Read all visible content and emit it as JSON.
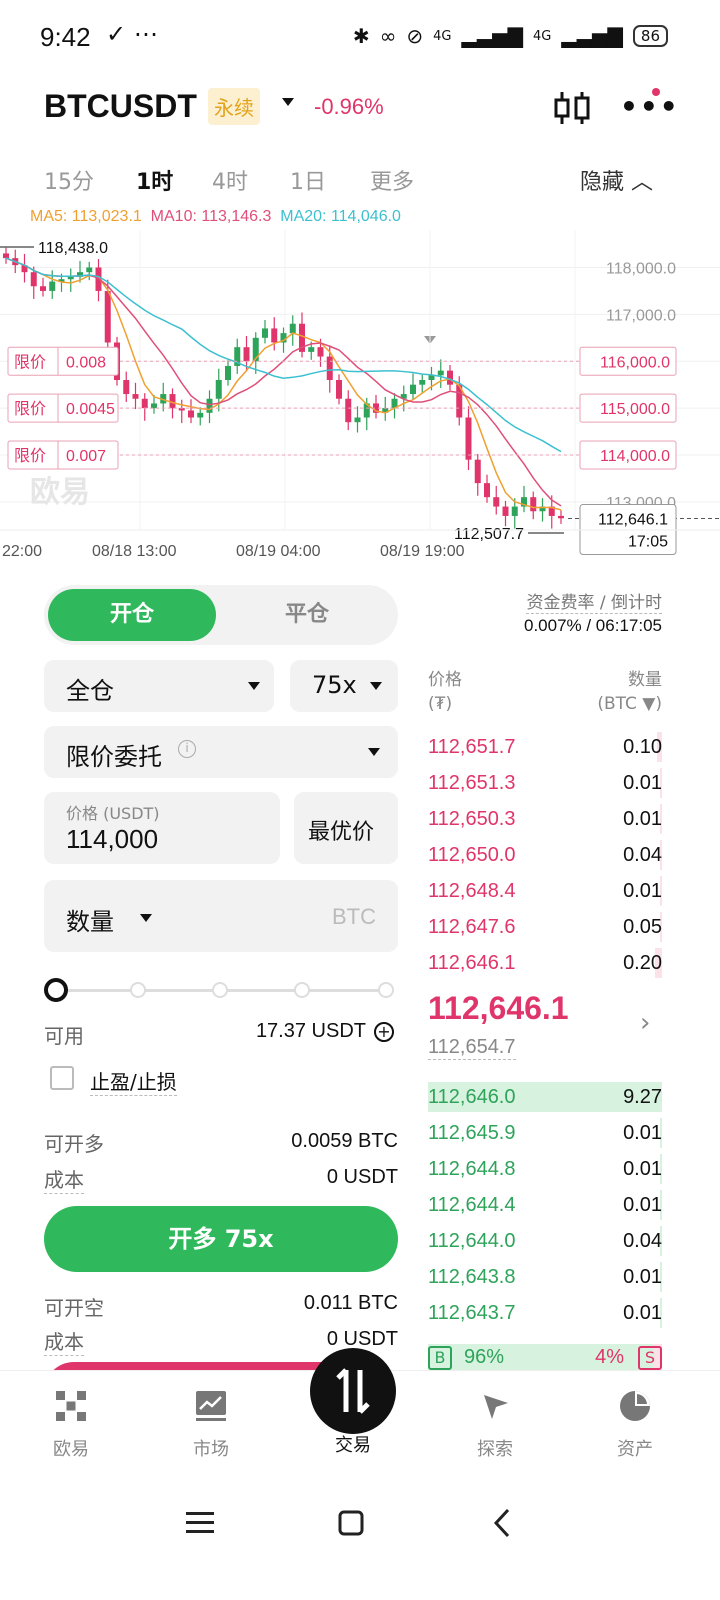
{
  "status_bar": {
    "time": "9:42",
    "network_1": "4G",
    "network_2": "4G",
    "battery": "86"
  },
  "header": {
    "symbol": "BTCUSDT",
    "contract_type": "永续",
    "change": "-0.96%"
  },
  "timeframes": [
    {
      "label": "15分",
      "active": false
    },
    {
      "label": "1时",
      "active": true
    },
    {
      "label": "4时",
      "active": false
    },
    {
      "label": "1日",
      "active": false
    },
    {
      "label": "更多",
      "active": false
    }
  ],
  "hide_label": "隐藏",
  "ma": {
    "ma5": "MA5: 113,023.1",
    "ma10": "MA10: 113,146.3",
    "ma20": "MA20: 114,046.0"
  },
  "colors": {
    "up": "#2ea35a",
    "down": "#e0356a",
    "ma5": "#f0a030",
    "ma10": "#e04f7a",
    "ma20": "#3cc0d0",
    "accent": "#30b95c"
  },
  "chart_data": {
    "type": "candlestick",
    "y_ticks": [
      "118,000.0",
      "117,000.0",
      "116,000.0",
      "115,000.0",
      "114,000.0",
      "113,000.0"
    ],
    "x_ticks": [
      "22:00",
      "08/18 13:00",
      "08/19 04:00",
      "08/19 19:00"
    ],
    "high_label": "118,438.0",
    "low_label": "112,507.7",
    "current_price": "112,646.1",
    "countdown": "17:05",
    "ylim": [
      112400,
      118800
    ],
    "orders": [
      {
        "label": "限价",
        "qty": "0.008",
        "price": 116000
      },
      {
        "label": "限价",
        "qty": "0.0045",
        "price": 115000
      },
      {
        "label": "限价",
        "qty": "0.007",
        "price": 114000
      }
    ],
    "watermark": "欧易"
  },
  "trade": {
    "tab_open": "开仓",
    "tab_close": "平仓",
    "funding_label": "资金费率 / 倒计时",
    "funding_value": "0.007% / 06:17:05",
    "margin_mode": "全仓",
    "leverage": "75x",
    "order_type": "限价委托",
    "price_label": "价格 (USDT)",
    "price_value": "114,000",
    "best_price": "最优价",
    "qty_label": "数量",
    "qty_placeholder": "BTC",
    "available_label": "可用",
    "available_value": "17.37 USDT",
    "tpsl_label": "止盈/止损",
    "long_max_label": "可开多",
    "long_max_value": "0.0059 BTC",
    "long_cost_label": "成本",
    "long_cost_value": "0 USDT",
    "buy_button": "开多 75x",
    "short_max_label": "可开空",
    "short_max_value": "0.011 BTC",
    "short_cost_label": "成本",
    "short_cost_value": "0 USDT",
    "slider_percent": 0
  },
  "orderbook": {
    "price_header": "价格",
    "price_unit": "(₮)",
    "qty_header": "数量",
    "qty_unit": "(BTC ▼)",
    "asks": [
      {
        "price": "112,651.7",
        "qty": "0.10",
        "depth": 0.02
      },
      {
        "price": "112,651.3",
        "qty": "0.01",
        "depth": 0.005
      },
      {
        "price": "112,650.3",
        "qty": "0.01",
        "depth": 0.005
      },
      {
        "price": "112,650.0",
        "qty": "0.04",
        "depth": 0.01
      },
      {
        "price": "112,648.4",
        "qty": "0.01",
        "depth": 0.005
      },
      {
        "price": "112,647.6",
        "qty": "0.05",
        "depth": 0.01
      },
      {
        "price": "112,646.1",
        "qty": "0.20",
        "depth": 0.03
      }
    ],
    "last_price": "112,646.1",
    "mark_price": "112,654.7",
    "bids": [
      {
        "price": "112,646.0",
        "qty": "9.27",
        "depth": 1.0
      },
      {
        "price": "112,645.9",
        "qty": "0.01",
        "depth": 0.005
      },
      {
        "price": "112,644.8",
        "qty": "0.01",
        "depth": 0.005
      },
      {
        "price": "112,644.4",
        "qty": "0.01",
        "depth": 0.005
      },
      {
        "price": "112,644.0",
        "qty": "0.04",
        "depth": 0.01
      },
      {
        "price": "112,643.8",
        "qty": "0.01",
        "depth": 0.005
      },
      {
        "price": "112,643.7",
        "qty": "0.01",
        "depth": 0.005
      }
    ],
    "buy_ratio_tag": "B",
    "buy_ratio": "96%",
    "sell_ratio": "4%",
    "sell_ratio_tag": "S"
  },
  "nav": [
    {
      "label": "欧易",
      "icon": "okx-logo-icon"
    },
    {
      "label": "市场",
      "icon": "market-chart-icon"
    },
    {
      "label": "交易",
      "icon": "trade-swap-icon"
    },
    {
      "label": "探索",
      "icon": "explore-compass-icon"
    },
    {
      "label": "资产",
      "icon": "assets-pie-icon"
    }
  ]
}
